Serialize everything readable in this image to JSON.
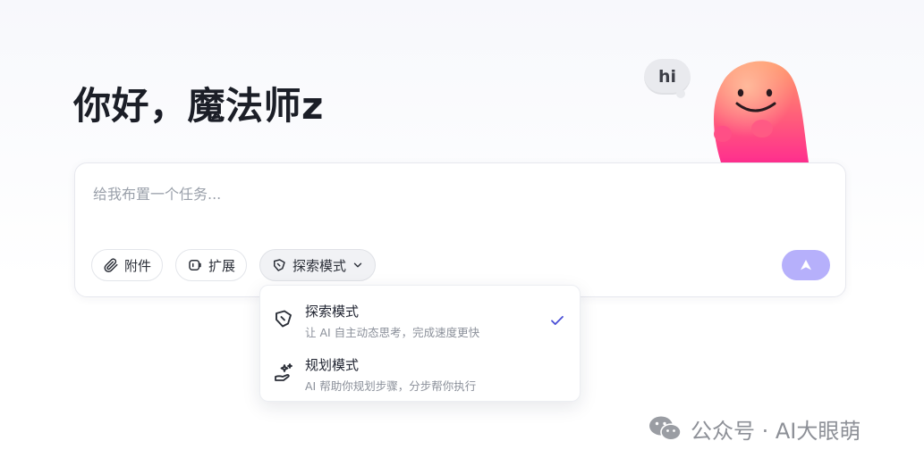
{
  "greeting": "你好，魔法师z",
  "mascot": {
    "bubble_text": "hi",
    "colors": {
      "body_top": "#ff8a5c",
      "body_bottom": "#ff3e8a",
      "bubble": "#e9eaee"
    }
  },
  "composer": {
    "placeholder": "给我布置一个任务...",
    "value": "",
    "attach_label": "附件",
    "extensions_label": "扩展",
    "mode_label": "探索模式",
    "send_icon": "send-arrow-icon",
    "send_color": "#b6b0fb"
  },
  "mode_menu": {
    "options": [
      {
        "title": "探索模式",
        "description": "让 AI 自主动态思考，完成速度更快",
        "icon": "explore-shield-icon",
        "selected": true
      },
      {
        "title": "规划模式",
        "description": "AI 帮助你规划步骤，分步帮你执行",
        "icon": "plan-sparkle-hand-icon",
        "selected": false
      }
    ],
    "check_color": "#4a4fd6"
  },
  "watermark": {
    "text": "公众号 · AI大眼萌",
    "icon": "wechat-icon"
  }
}
